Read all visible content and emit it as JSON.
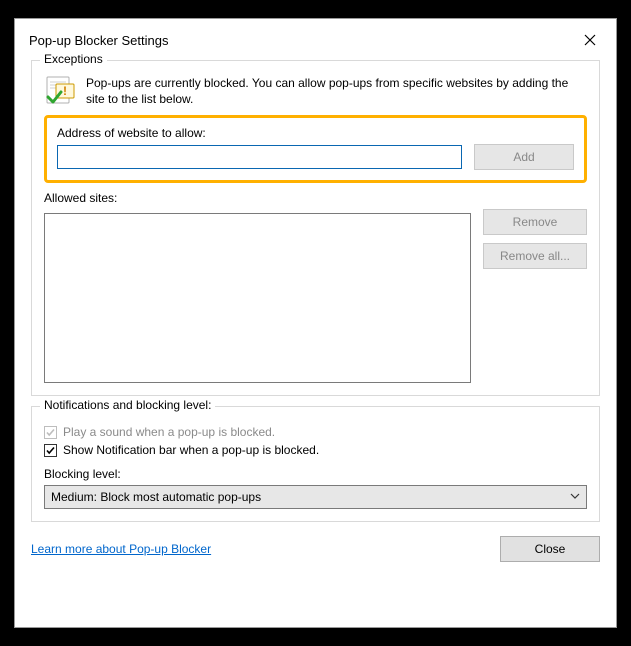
{
  "window": {
    "title": "Pop-up Blocker Settings"
  },
  "exceptions": {
    "legend": "Exceptions",
    "intro": "Pop-ups are currently blocked.  You can allow pop-ups from specific websites by adding the site to the list below.",
    "address_label": "Address of website to allow:",
    "address_value": "",
    "add_label": "Add",
    "allowed_label": "Allowed sites:",
    "remove_label": "Remove",
    "remove_all_label": "Remove all..."
  },
  "notifications": {
    "legend": "Notifications and blocking level:",
    "play_sound_label": "Play a sound when a pop-up is blocked.",
    "play_sound_checked": true,
    "show_bar_label": "Show Notification bar when a pop-up is blocked.",
    "show_bar_checked": true,
    "blocking_level_label": "Blocking level:",
    "blocking_level_value": "Medium: Block most automatic pop-ups"
  },
  "footer": {
    "learn_more": "Learn more about Pop-up Blocker",
    "close_label": "Close"
  }
}
